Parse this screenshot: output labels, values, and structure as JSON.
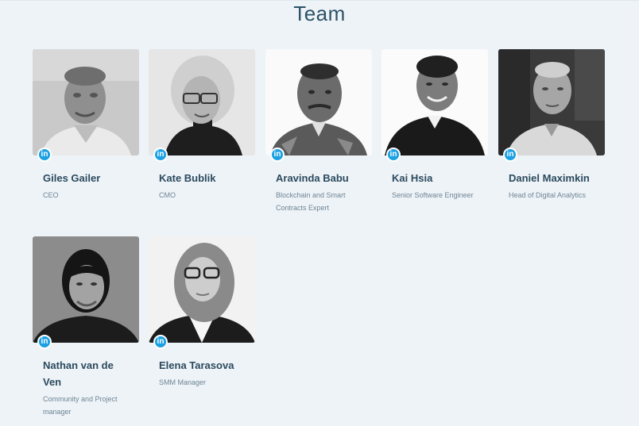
{
  "section": {
    "title": "Team"
  },
  "members": [
    {
      "name": "Giles Gailer",
      "role": "CEO",
      "linkedin_icon": "linkedin-icon",
      "linkedin_label": "in"
    },
    {
      "name": "Kate Bublik",
      "role": "CMO",
      "linkedin_icon": "linkedin-icon",
      "linkedin_label": "in"
    },
    {
      "name": "Aravinda Babu",
      "role": "Blockchain and Smart Contracts Expert",
      "linkedin_icon": "linkedin-icon",
      "linkedin_label": "in"
    },
    {
      "name": "Kai Hsia",
      "role": "Senior Software Engineer",
      "linkedin_icon": "linkedin-icon",
      "linkedin_label": "in"
    },
    {
      "name": "Daniel Maximkin",
      "role": "Head of Digital Analytics",
      "linkedin_icon": "linkedin-icon",
      "linkedin_label": "in"
    },
    {
      "name": "Nathan van de Ven",
      "role": "Community and Project manager",
      "linkedin_icon": "linkedin-icon",
      "linkedin_label": "in"
    },
    {
      "name": "Elena Tarasova",
      "role": "SMM Manager",
      "linkedin_icon": "linkedin-icon",
      "linkedin_label": "in"
    }
  ],
  "colors": {
    "background": "#eef3f7",
    "title": "#2c5367",
    "name": "#2b4a5e",
    "role": "#6d8494",
    "linkedin": "#1ba1e2"
  }
}
